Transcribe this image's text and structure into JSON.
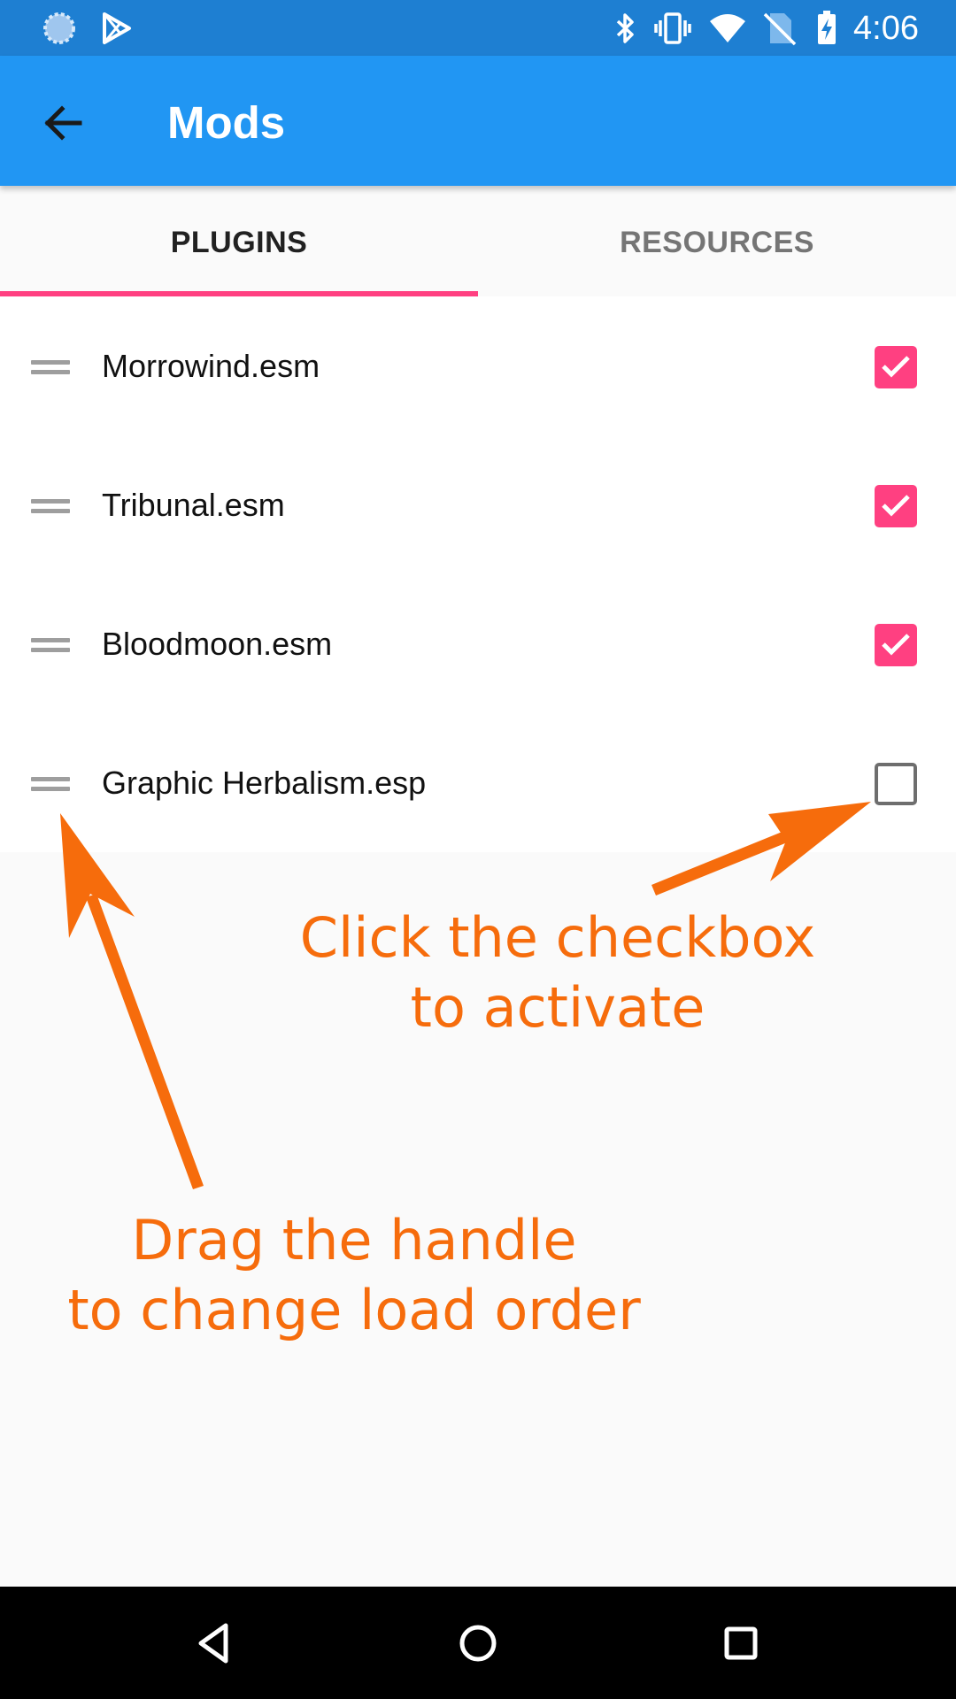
{
  "status_bar": {
    "time": "4:06",
    "left_icons": [
      "loading-spinner-icon",
      "play-store-icon"
    ],
    "right_icons": [
      "bluetooth-icon",
      "vibrate-icon",
      "wifi-icon",
      "no-sim-icon",
      "battery-charging-icon"
    ]
  },
  "app_bar": {
    "title": "Mods",
    "back_icon": "arrow-back-icon",
    "color": "#2196f3"
  },
  "tabs": [
    {
      "label": "PLUGINS",
      "active": true
    },
    {
      "label": "RESOURCES",
      "active": false
    }
  ],
  "plugins": [
    {
      "name": "Morrowind.esm",
      "enabled": true
    },
    {
      "name": "Tribunal.esm",
      "enabled": true
    },
    {
      "name": "Bloodmoon.esm",
      "enabled": true
    },
    {
      "name": "Graphic Herbalism.esp",
      "enabled": false
    }
  ],
  "annotations": {
    "checkbox_hint": [
      "Click the checkbox",
      "to activate"
    ],
    "handle_hint": [
      "Drag the handle",
      "to change load order"
    ],
    "color": "#f66c0c"
  },
  "nav_bar": {
    "buttons": [
      "back-triangle-icon",
      "home-circle-icon",
      "recents-square-icon"
    ]
  },
  "colors": {
    "accent": "#ff4081",
    "status_bar": "#1e7fd2"
  }
}
